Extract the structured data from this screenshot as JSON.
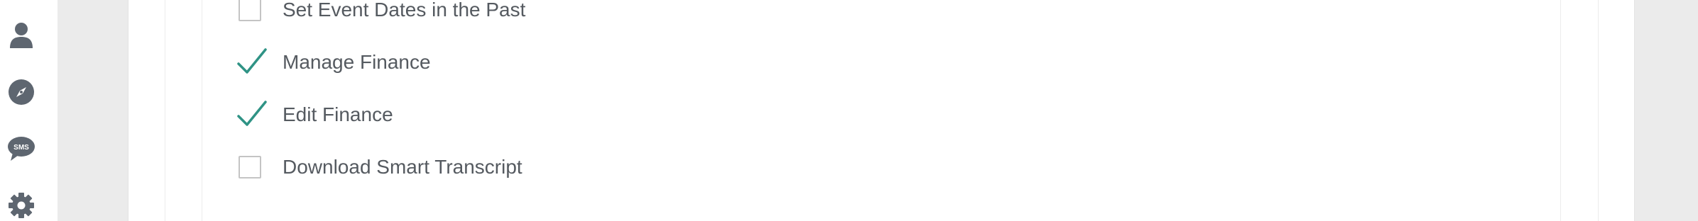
{
  "sidebar": {
    "items": [
      {
        "icon": "user-icon"
      },
      {
        "icon": "compass-icon"
      },
      {
        "icon": "sms-icon",
        "badge_text": "SMS"
      },
      {
        "icon": "gear-icon"
      }
    ]
  },
  "permissions": [
    {
      "label": "Set Event Dates in the Past",
      "checked": false
    },
    {
      "label": "Manage Finance",
      "checked": true
    },
    {
      "label": "Edit Finance",
      "checked": true
    },
    {
      "label": "Download Smart Transcript",
      "checked": false
    }
  ],
  "colors": {
    "check": "#2f9385",
    "sidebar_icon": "#5e6670",
    "label_text": "#555a60"
  }
}
